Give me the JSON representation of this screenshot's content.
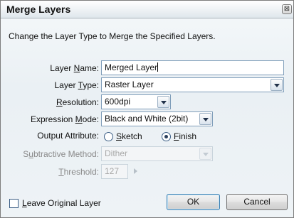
{
  "dialog": {
    "title": "Merge Layers",
    "close_glyph": "⊠",
    "description": "Change the Layer Type to Merge the Specified Layers."
  },
  "form": {
    "layer_name": {
      "label_pre": "Layer ",
      "label_key": "N",
      "label_post": "ame:",
      "value": "Merged Layer"
    },
    "layer_type": {
      "label_pre": "Layer ",
      "label_key": "T",
      "label_post": "ype:",
      "value": "Raster Layer"
    },
    "resolution": {
      "label_pre": "",
      "label_key": "R",
      "label_post": "esolution:",
      "value": "600dpi"
    },
    "expression_mode": {
      "label_pre": "Expression ",
      "label_key": "M",
      "label_post": "ode:",
      "value": "Black and White (2bit)"
    },
    "output_attribute": {
      "label": "Output Attribute:",
      "options": [
        {
          "key": "S",
          "rest": "ketch",
          "selected": false
        },
        {
          "key": "F",
          "rest": "inish",
          "selected": true
        }
      ]
    },
    "subtractive_method": {
      "label_pre": "S",
      "label_key": "u",
      "label_post": "btractive Method:",
      "value": "Dither"
    },
    "threshold": {
      "label_pre": "",
      "label_key": "T",
      "label_post": "hreshold:",
      "value": "127"
    }
  },
  "footer": {
    "leave_original": {
      "key": "L",
      "rest": "eave Original Layer",
      "checked": false
    },
    "ok_label": "OK",
    "cancel_label": "Cancel"
  }
}
